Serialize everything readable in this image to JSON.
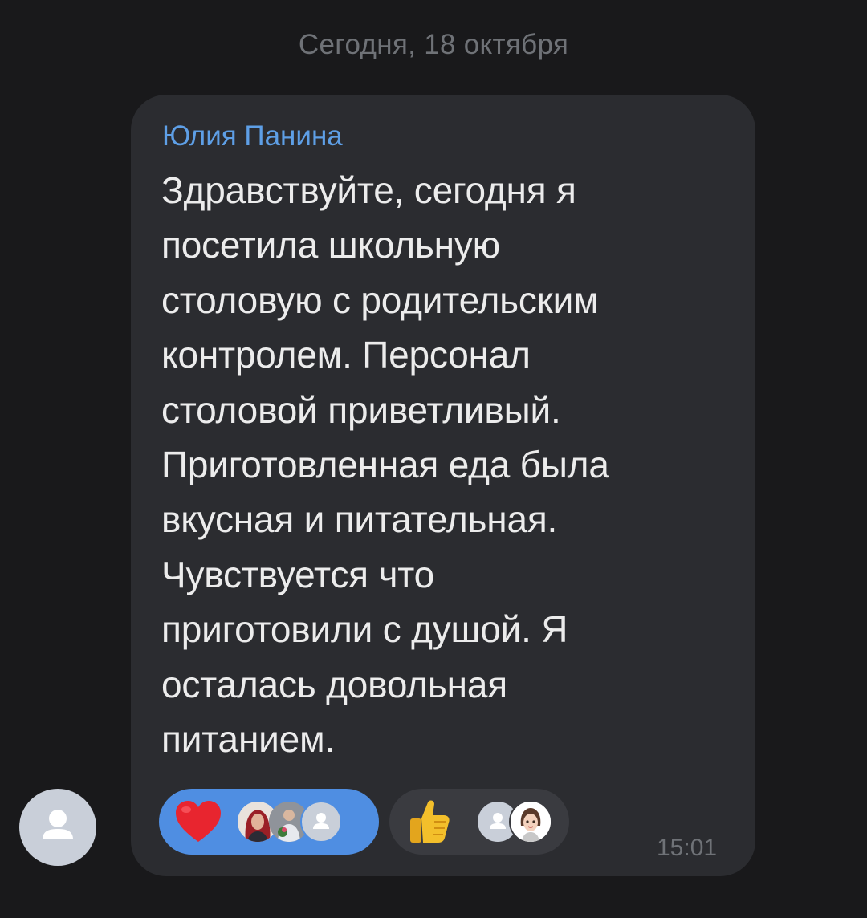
{
  "chat": {
    "date_separator": "Сегодня, 18 октября"
  },
  "message": {
    "sender": "Юлия Панина",
    "text": "Здравствуйте, сегодня я\nпосетила школьную\nстоловую с родительским\nконтролем. Персонал\nстоловой приветливый.\nПриготовленная еда была\nвкусная и питательная.\nЧувствуется  что\nприготовили с душой.  Я\nосталась довольная\nпитанием.",
    "time": "15:01",
    "sender_color": "#5e9fe6"
  },
  "reactions": [
    {
      "emoji_icon": "heart-icon",
      "selected": true,
      "reactor_avatars": [
        "woman-red-hair-avatar",
        "man-with-flowers-avatar",
        "default-user-avatar"
      ]
    },
    {
      "emoji_icon": "thumbs-up-icon",
      "selected": false,
      "reactor_avatars": [
        "default-user-avatar",
        "cartoon-girl-avatar"
      ]
    }
  ],
  "colors": {
    "background": "#19191b",
    "bubble": "#2b2c30",
    "selected_reaction": "#4f8ee2",
    "reaction": "#3a3b40"
  }
}
